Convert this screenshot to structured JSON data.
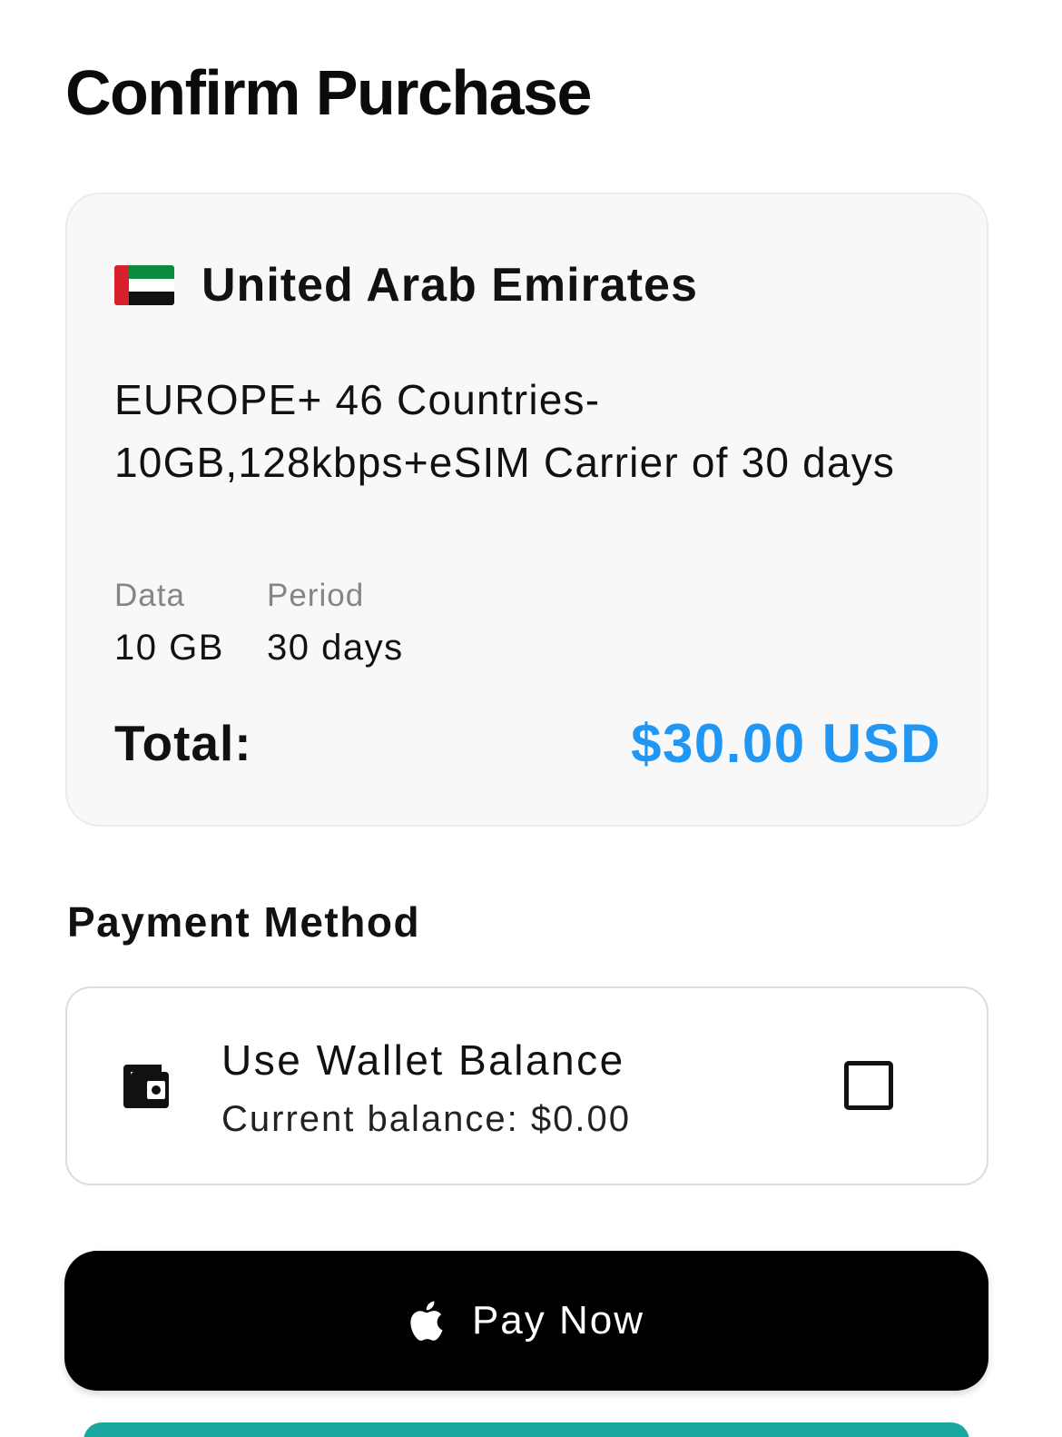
{
  "header": {
    "title": "Confirm Purchase"
  },
  "summary": {
    "flag_icon": "uae-flag-icon",
    "country": "United Arab Emirates",
    "plan_name": "EUROPE+ 46 Countries-10GB,128kbps+eSIM Carrier of 30 days",
    "data_label": "Data",
    "data_value": "10 GB",
    "period_label": "Period",
    "period_value": "30 days",
    "total_label": "Total:",
    "total_value": "$30.00 USD"
  },
  "payment": {
    "section_title": "Payment Method",
    "wallet_icon": "wallet-icon",
    "wallet_title": "Use Wallet Balance",
    "wallet_balance": "Current balance: $0.00",
    "wallet_checked": false
  },
  "actions": {
    "pay_icon": "apple-icon",
    "pay_label": "Pay Now"
  },
  "colors": {
    "accent": "#2196f3",
    "button_bg": "#000000",
    "card_bg": "#f8f8f8",
    "secondary_button": "#19a7a0"
  }
}
